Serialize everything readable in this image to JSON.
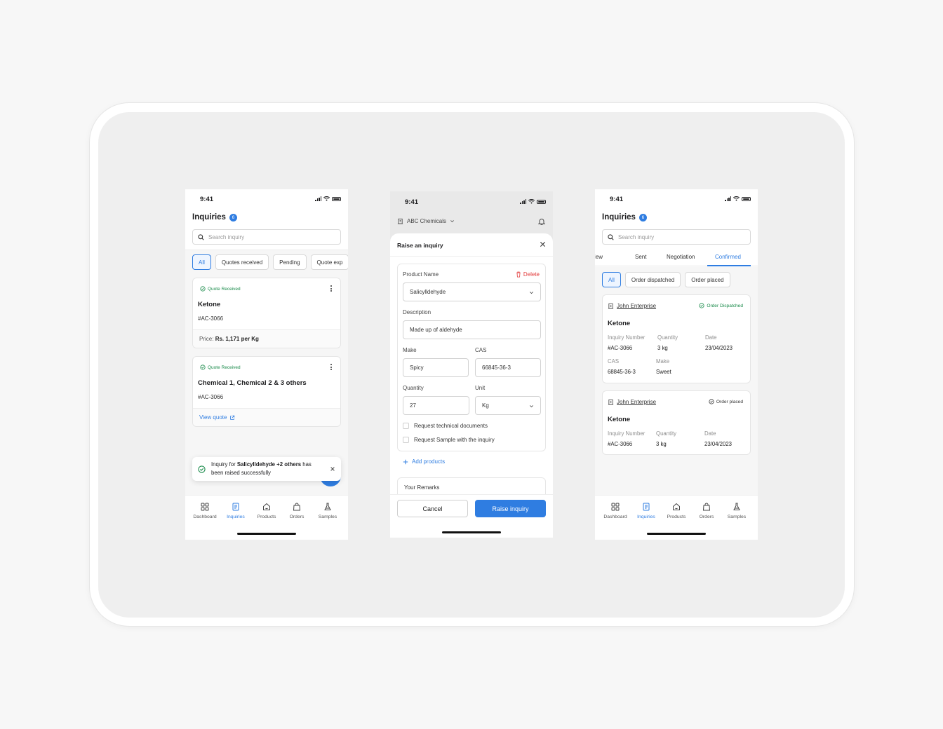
{
  "status_time": "9:41",
  "tabbar": [
    "Dashboard",
    "Inquiries",
    "Products",
    "Orders",
    "Samples"
  ],
  "accent": "#2f7de1",
  "success_color": "#188a49",
  "danger_color": "#e23b3b",
  "screen1": {
    "title": "Inquiries",
    "badge": "6",
    "search_placeholder": "Search inquiry",
    "chips": [
      "All",
      "Quotes received",
      "Pending",
      "Quote exp"
    ],
    "cards": [
      {
        "status": "Quote Received",
        "product": "Ketone",
        "inquiry_no": "#AC-3066",
        "footer_label": "Price:",
        "footer_value": "Rs. 1,171 per Kg"
      },
      {
        "status": "Quote Received",
        "product": "Chemical 1, Chemical 2 & 3 others",
        "inquiry_no": "#AC-3066",
        "footer_link": "View quote"
      }
    ],
    "toast": {
      "prefix": "Inquiry for ",
      "bold": "Salicylldehyde +2 others",
      "suffix": " has been raised successfully"
    }
  },
  "screen2": {
    "company": "ABC Chemicals",
    "sheet_title": "Raise an inquiry",
    "product_name_label": "Product Name",
    "delete_label": "Delete",
    "product_name_value": "Salicylldehyde",
    "description_label": "Description",
    "description_value": "Made up of aldehyde",
    "make_label": "Make",
    "make_value": "Spicy",
    "cas_label": "CAS",
    "cas_value": "66845-36-3",
    "quantity_label": "Quantity",
    "quantity_value": "27",
    "unit_label": "Unit",
    "unit_value": "Kg",
    "checkbox_1": "Request technical documents",
    "checkbox_2": "Request Sample with the inquiry",
    "add_products": "Add products",
    "remarks_label": "Your Remarks",
    "cancel_label": "Cancel",
    "raise_label": "Raise inquiry"
  },
  "screen3": {
    "title": "Inquiries",
    "badge": "6",
    "search_placeholder": "Search inquiry",
    "status_tabs": [
      "New",
      "Sent",
      "Negotiation",
      "Confirmed"
    ],
    "chips": [
      "All",
      "Order dispatched",
      "Order placed"
    ],
    "orders": [
      {
        "firm": "John Enterprise",
        "status": "Order Dispatched",
        "product": "Ketone",
        "inquiry_label": "Inquiry Number",
        "inquiry_no": "#AC-3066",
        "qty_label": "Quantity",
        "qty": "3 kg",
        "date_label": "Date",
        "date": "23/04/2023",
        "cas_label": "CAS",
        "cas": "68845-36-3",
        "make_label": "Make",
        "make": "Sweet"
      },
      {
        "firm": "John Enterprise",
        "status": "Order placed",
        "product": "Ketone",
        "inquiry_label": "Inquiry Number",
        "inquiry_no": "#AC-3066",
        "qty_label": "Quantity",
        "qty": "3 kg",
        "date_label": "Date",
        "date": "23/04/2023"
      }
    ]
  }
}
